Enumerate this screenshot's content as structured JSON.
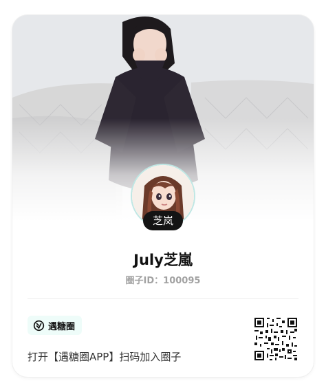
{
  "cover": {
    "description_icon": "cover-photo"
  },
  "profile": {
    "avatar_icon": "avatar-illustration",
    "name_badge": "芝岚",
    "circle_name": "July芝嵐",
    "circle_id_label": "圈子ID：100095"
  },
  "footer": {
    "brand_name": "遇糖圈",
    "brand_icon": "brand-logo-icon",
    "cta_text": "打开【遇糖圈APP】扫码加入圈子",
    "qr_icon": "qr-code"
  },
  "colors": {
    "accent_bg": "#eefcf9",
    "avatar_ring": "#bfe7e4",
    "pill_bg": "#141414"
  }
}
